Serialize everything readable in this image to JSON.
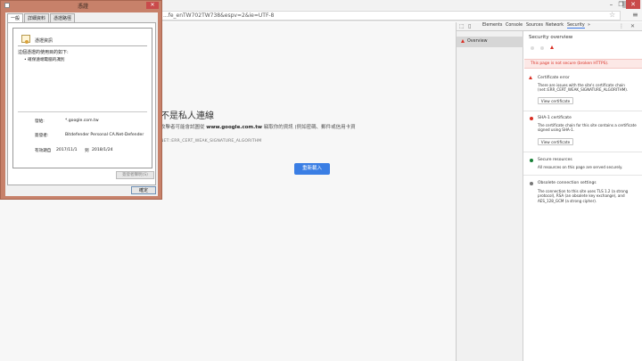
{
  "browser": {
    "url": "&q=%E5%A4%A9%E6%B0%A3&oq=%E5%A4%A9%E6%B0%A3&gs_l=%E5%A4%A9%E6%B0%A3.0...1...3...0&ie=UTF-8#q=%E5%A4%A9%E6%B0%A3&spf=...fe_enTW702TW738&espv=2&ie=UTF-8",
    "url_visible": "...fe_enTW702TW738&espv=2&ie=UTF-8"
  },
  "page": {
    "title": "不是私人連線",
    "desc_prefix": "攻擊者可能會試圖從",
    "desc_host": "www.google.com.tw",
    "desc_suffix": "竊取你的資訊 (例如密碼、郵件或信用卡資",
    "error_code": "NET::ERR_CERT_WEAK_SIGNATURE_ALGORITHM",
    "back_button": "重新載入"
  },
  "dialog": {
    "title": "憑證",
    "close": "✕",
    "tabs": [
      "一般",
      "詳細資料",
      "憑證路徑"
    ],
    "info_header": "憑證資訊",
    "purpose_title": "這個憑證的使用目的如下:",
    "purpose_items": [
      "• 確保遠端電腦的識別"
    ],
    "issued_to_label": "發給:",
    "issued_to": "*.google.com.tw",
    "issued_by_label": "簽發者:",
    "issued_by": "Bitdefender Personal CA.Net-Defender",
    "valid_label": "有效期自",
    "valid_from": "2017/11/1",
    "valid_to_word": "到",
    "valid_to": "2018/1/24",
    "statement_button": "簽發者聲明(S)",
    "ok_button": "確定"
  },
  "devtools": {
    "tabs": [
      "Elements",
      "Console",
      "Sources",
      "Network",
      "Security"
    ],
    "more": "»",
    "sidebar_item": "Overview",
    "overview_title": "Security overview",
    "alert": "This page is not secure (broken HTTPS).",
    "items": [
      {
        "title": "Certificate error",
        "desc": "There are issues with the site's certificate chain (net::ERR_CERT_WEAK_SIGNATURE_ALGORITHM).",
        "button": "View certificate",
        "status": "red"
      },
      {
        "title": "SHA-1 certificate",
        "desc": "The certificate chain for this site contains a certificate signed using SHA-1.",
        "button": "View certificate",
        "status": "red"
      },
      {
        "title": "Secure resources",
        "desc": "All resources on this page are served securely.",
        "status": "green"
      },
      {
        "title": "Obsolete connection settings",
        "desc": "The connection to this site uses TLS 1.2 (a strong protocol), RSA (an obsolete key exchange), and AES_128_GCM (a strong cipher).",
        "status": "grey"
      }
    ]
  },
  "colors": {
    "accent": "#3a7ee4",
    "dialog_frame": "#c7816a",
    "error": "#d93025",
    "secure": "#188038"
  }
}
